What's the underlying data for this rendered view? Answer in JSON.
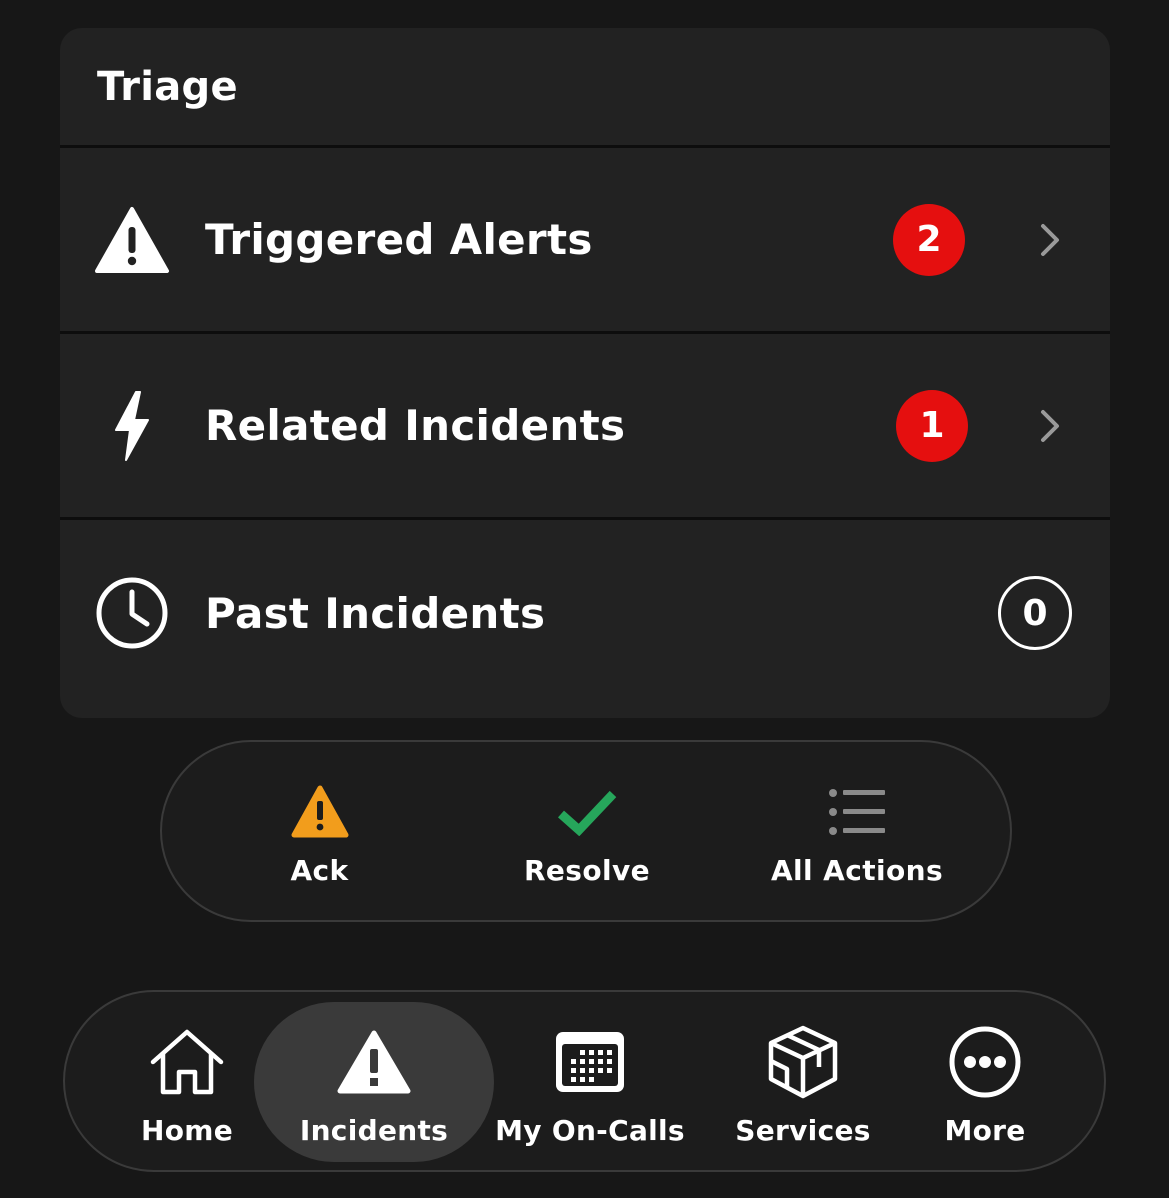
{
  "triage": {
    "title": "Triage",
    "rows": [
      {
        "label": "Triggered Alerts",
        "count": "2",
        "icon": "warning-triangle-icon",
        "has_chevron": true
      },
      {
        "label": "Related Incidents",
        "count": "1",
        "icon": "lightning-bolt-icon",
        "has_chevron": true
      },
      {
        "label": "Past Incidents",
        "count": "0",
        "icon": "clock-icon",
        "has_chevron": false
      }
    ]
  },
  "actions": {
    "ack": {
      "label": "Ack",
      "icon": "warning-triangle-icon",
      "color": "#f29d1c"
    },
    "resolve": {
      "label": "Resolve",
      "icon": "checkmark-icon",
      "color": "#26a65b"
    },
    "all_actions": {
      "label": "All Actions",
      "icon": "list-icon",
      "color": "#8a8a8a"
    }
  },
  "tabbar": {
    "active": "Incidents",
    "tabs": [
      {
        "label": "Home",
        "icon": "home-icon"
      },
      {
        "label": "Incidents",
        "icon": "warning-triangle-icon"
      },
      {
        "label": "My On-Calls",
        "icon": "calendar-icon"
      },
      {
        "label": "Services",
        "icon": "cube-icon"
      },
      {
        "label": "More",
        "icon": "more-dots-icon"
      }
    ]
  },
  "colors": {
    "background": "#171717",
    "card": "#222222",
    "badge_red": "#e50f0f",
    "active_tab": "#3a3a3a"
  }
}
